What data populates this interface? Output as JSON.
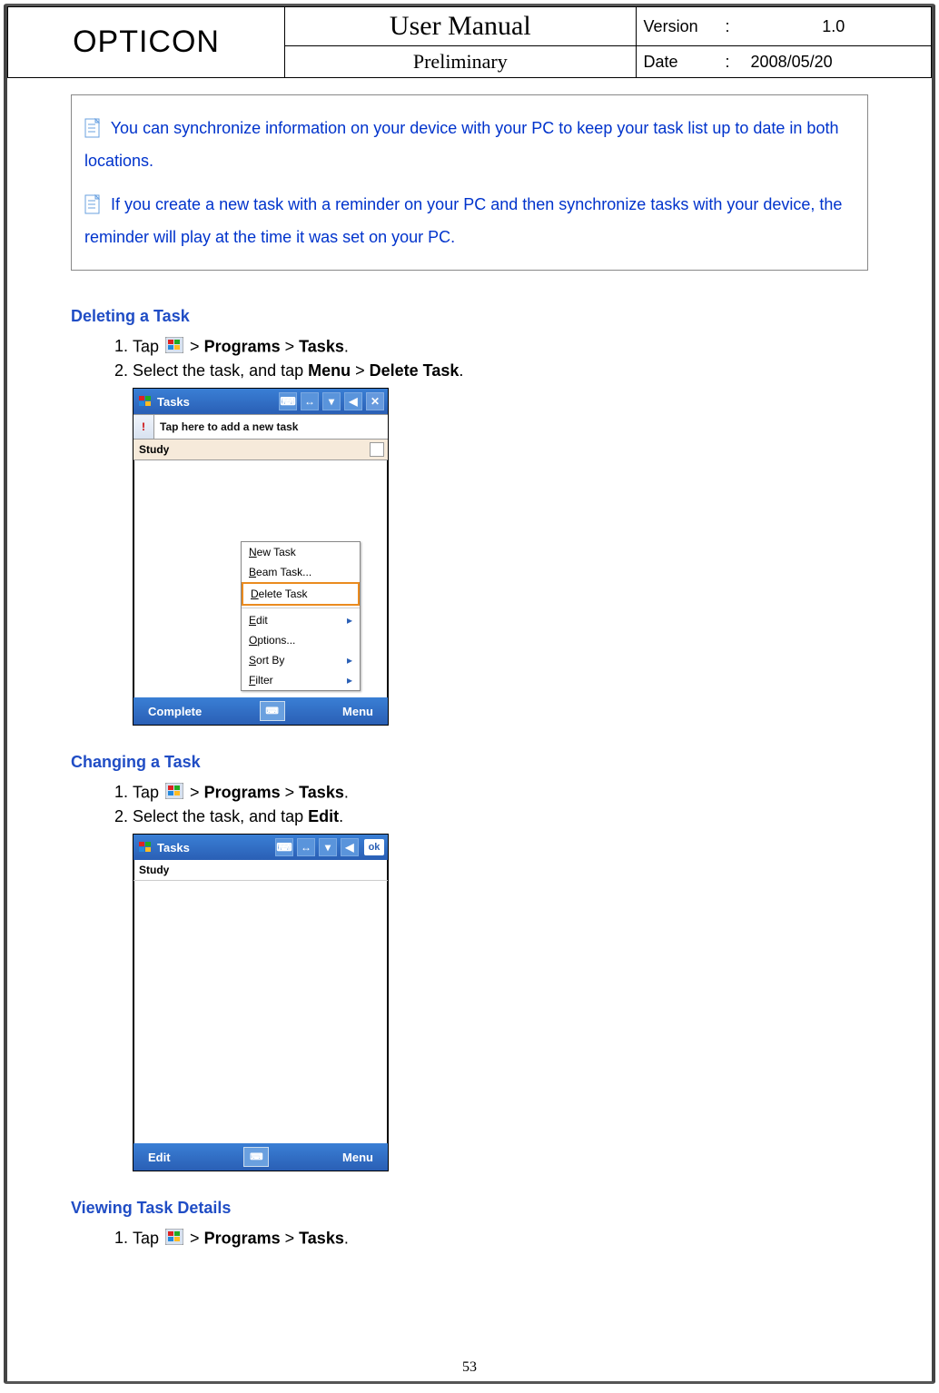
{
  "header": {
    "brand": "OPTICON",
    "title": "User Manual",
    "subtitle": "Preliminary",
    "version_label": "Version",
    "version_value": "1.0",
    "date_label": "Date",
    "date_value": "2008/05/20"
  },
  "notes": {
    "n1": "You can synchronize information on your device with your PC to keep your task list up to date in both locations.",
    "n2": "If you create a new task with a reminder on your PC and then synchronize tasks with your device, the reminder will play at the time it was set on your PC."
  },
  "sections": {
    "deleting": {
      "heading": "Deleting a Task",
      "step1_pre": "Tap ",
      "step1_post": " > ",
      "step1_bold1": "Programs",
      "step1_sep": " > ",
      "step1_bold2": "Tasks",
      "step1_end": ".",
      "step2_a": "Select the task, and tap ",
      "step2_b1": "Menu",
      "step2_sep": " > ",
      "step2_b2": "Delete Task",
      "step2_end": "."
    },
    "changing": {
      "heading": "Changing a Task",
      "step1_pre": "Tap ",
      "step1_post": " > ",
      "step1_bold1": "Programs",
      "step1_sep": " > ",
      "step1_bold2": "Tasks",
      "step1_end": ".",
      "step2_a": "Select the task, and tap ",
      "step2_b1": "Edit",
      "step2_end": "."
    },
    "viewing": {
      "heading": "Viewing Task Details",
      "step1_pre": "Tap ",
      "step1_post": " > ",
      "step1_bold1": "Programs",
      "step1_sep": " > ",
      "step1_bold2": "Tasks",
      "step1_end": "."
    }
  },
  "screenshot1": {
    "title": "Tasks",
    "input_placeholder": "Tap here to add a new task",
    "selected": "Study",
    "menu": {
      "new": "New Task",
      "beam": "Beam Task...",
      "del": "Delete Task",
      "edit": "Edit",
      "options": "Options...",
      "sort": "Sort By",
      "filter": "Filter"
    },
    "left_btn": "Complete",
    "right_btn": "Menu"
  },
  "screenshot2": {
    "title": "Tasks",
    "study": "Study",
    "ok": "ok",
    "left_btn": "Edit",
    "right_btn": "Menu"
  },
  "page_number": "53"
}
